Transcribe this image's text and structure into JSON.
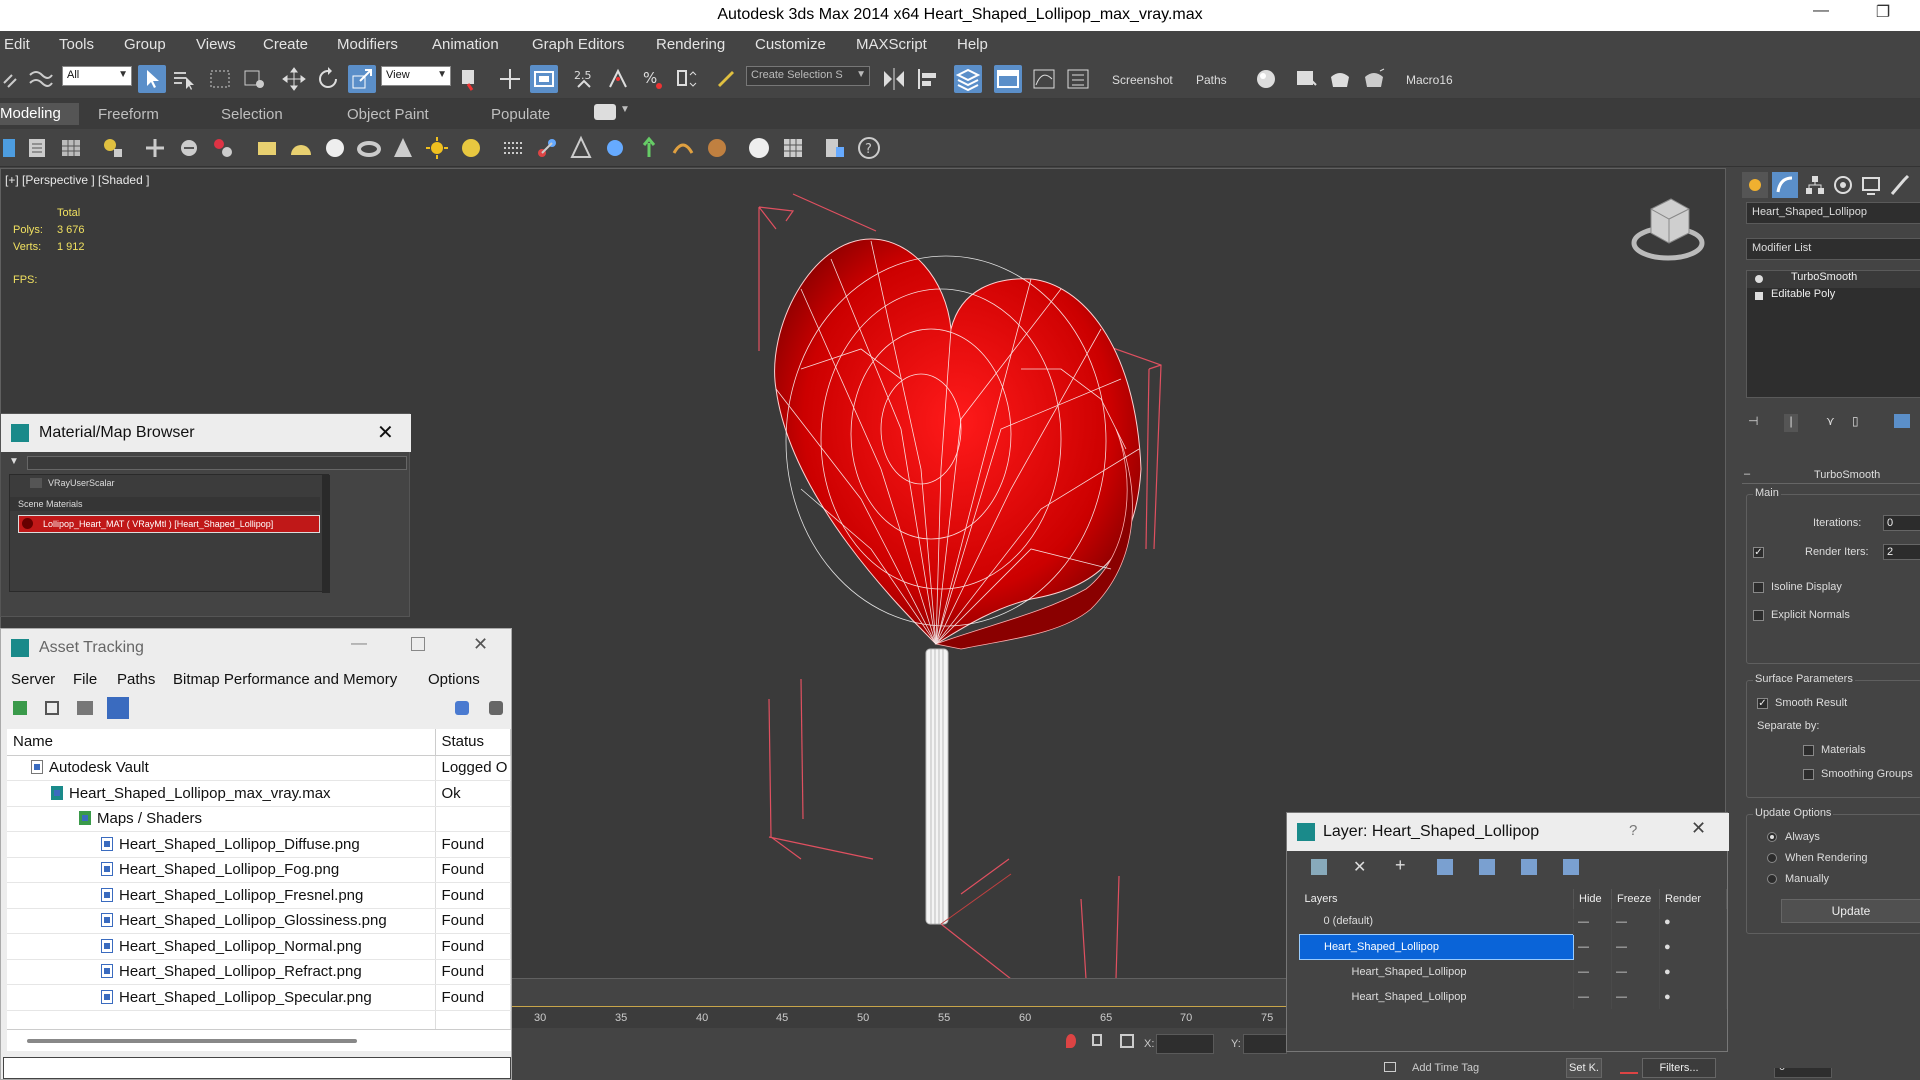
{
  "window": {
    "title": "Autodesk 3ds Max  2014 x64      Heart_Shaped_Lollipop_max_vray.max",
    "minimize_glyph": "—",
    "restore_glyph": "❐"
  },
  "menu": [
    "Edit",
    "Tools",
    "Group",
    "Views",
    "Create",
    "Modifiers",
    "Animation",
    "Graph Editors",
    "Rendering",
    "Customize",
    "MAXScript",
    "Help"
  ],
  "toolbar": {
    "filter_value": "All",
    "refcoord_value": "View",
    "selection_set_placeholder": "Create Selection S",
    "screenshot_label": "Screenshot",
    "paths_label": "Paths",
    "macro_label": "Macro16"
  },
  "ribbon": {
    "tabs": [
      "Modeling",
      "Freeform",
      "Selection",
      "Object Paint",
      "Populate"
    ]
  },
  "viewport": {
    "label": "[+] [Perspective ] [Shaded ]",
    "stats": {
      "header": "Total",
      "polys_label": "Polys:",
      "polys_value": "3 676",
      "verts_label": "Verts:",
      "verts_value": "1 912",
      "fps_label": "FPS:"
    }
  },
  "material_browser": {
    "title": "Material/Map Browser",
    "item_top": "VRayUserScalar",
    "section": "Scene Materials",
    "material": "Lollipop_Heart_MAT ( VRayMtl ) [Heart_Shaped_Lollipop]"
  },
  "asset_tracking": {
    "title": "Asset Tracking",
    "menu": [
      "Server",
      "File",
      "Paths",
      "Bitmap Performance and Memory",
      "Options"
    ],
    "columns": [
      "Name",
      "Status"
    ],
    "rows": [
      {
        "name": "Autodesk Vault",
        "status": "Logged O"
      },
      {
        "name": "Heart_Shaped_Lollipop_max_vray.max",
        "status": "Ok"
      },
      {
        "name": "Maps / Shaders",
        "status": ""
      },
      {
        "name": "Heart_Shaped_Lollipop_Diffuse.png",
        "status": "Found"
      },
      {
        "name": "Heart_Shaped_Lollipop_Fog.png",
        "status": "Found"
      },
      {
        "name": "Heart_Shaped_Lollipop_Fresnel.png",
        "status": "Found"
      },
      {
        "name": "Heart_Shaped_Lollipop_Glossiness.png",
        "status": "Found"
      },
      {
        "name": "Heart_Shaped_Lollipop_Normal.png",
        "status": "Found"
      },
      {
        "name": "Heart_Shaped_Lollipop_Refract.png",
        "status": "Found"
      },
      {
        "name": "Heart_Shaped_Lollipop_Specular.png",
        "status": "Found"
      }
    ]
  },
  "layer_panel": {
    "title": "Layer: Heart_Shaped_Lollipop",
    "help": "?",
    "columns": [
      "Layers",
      "Hide",
      "Freeze",
      "Render"
    ],
    "rows": [
      {
        "name": "0 (default)",
        "selected": false
      },
      {
        "name": "Heart_Shaped_Lollipop",
        "selected": true
      },
      {
        "name": "Heart_Shaped_Lollipop",
        "selected": false
      },
      {
        "name": "Heart_Shaped_Lollipop",
        "selected": false
      }
    ]
  },
  "command_panel": {
    "object_name": "Heart_Shaped_Lollipop",
    "modifier_list": "Modifier List",
    "stack": [
      "TurboSmooth",
      "Editable Poly"
    ],
    "rollout_title": "TurboSmooth",
    "main_label": "Main",
    "iterations_label": "Iterations:",
    "iterations_value": "0",
    "render_iters_label": "Render Iters:",
    "render_iters_value": "2",
    "isoline": "Isoline Display",
    "explicit_normals": "Explicit Normals",
    "surface_params": "Surface Parameters",
    "smooth_result": "Smooth Result",
    "separate_by": "Separate by:",
    "materials": "Materials",
    "smoothing_groups": "Smoothing Groups",
    "update_options": "Update Options",
    "always": "Always",
    "when_rendering": "When Rendering",
    "manually": "Manually",
    "update_button": "Update"
  },
  "timeline": {
    "ticks": [
      "30",
      "35",
      "40",
      "45",
      "50",
      "55",
      "60",
      "65",
      "70",
      "75"
    ]
  },
  "statusbar": {
    "x_label": "X:",
    "y_label": "Y:",
    "add_time_tag": "Add Time Tag",
    "set_key": "Set K.",
    "filters": "Filters...",
    "frame_value": "0"
  },
  "colors": {
    "accent": "#5b8fc9",
    "heart_red": "#d40000",
    "wire": "#ffffff",
    "bbox": "#e05060",
    "stat_yellow": "#f0e060"
  }
}
